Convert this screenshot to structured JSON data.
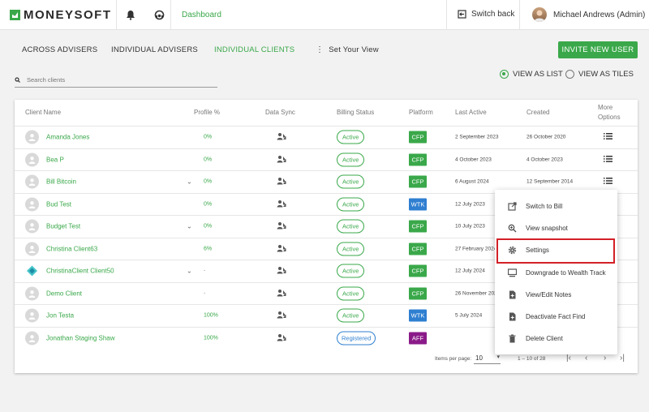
{
  "header": {
    "logo": "MONEYSOFT",
    "dashboard": "Dashboard",
    "switch_back": "Switch back",
    "user_name": "Michael Andrews (Admin)"
  },
  "subnav": {
    "across": "ACROSS ADVISERS",
    "individual_advisers": "INDIVIDUAL ADVISERS",
    "individual_clients": "INDIVIDUAL CLIENTS",
    "set_view": "Set Your View",
    "invite": "INVITE NEW USER"
  },
  "search": {
    "placeholder": "Search clients"
  },
  "view": {
    "list": "VIEW AS LIST",
    "tiles": "VIEW AS TILES",
    "selected": "list"
  },
  "table": {
    "columns": {
      "client_name": "Client Name",
      "profile": "Profile %",
      "data_sync": "Data Sync",
      "billing": "Billing Status",
      "platform": "Platform",
      "last_active": "Last Active",
      "created": "Created",
      "more_1": "More",
      "more_2": "Options"
    },
    "rows": [
      {
        "name": "Amanda Jones",
        "profile": "0%",
        "status": "Active",
        "platform": "CFP",
        "last_active": "2 September 2023",
        "created": "26 October 2020"
      },
      {
        "name": "Bea P",
        "profile": "0%",
        "status": "Active",
        "platform": "CFP",
        "last_active": "4 October 2023",
        "created": "4 October 2023"
      },
      {
        "name": "Bill Bitcoin",
        "profile": "0%",
        "status": "Active",
        "platform": "CFP",
        "last_active": "6 August 2024",
        "created": "12 September 2014"
      },
      {
        "name": "Bud Test",
        "profile": "0%",
        "status": "Active",
        "platform": "WTK",
        "last_active": "12 July 2023",
        "created": ""
      },
      {
        "name": "Budget Test",
        "profile": "0%",
        "status": "Active",
        "platform": "CFP",
        "last_active": "10 July 2023",
        "created": ""
      },
      {
        "name": "Christina Client63",
        "profile": "6%",
        "status": "Active",
        "platform": "CFP",
        "last_active": "27 February 2024",
        "created": ""
      },
      {
        "name": "ChristinaClient Client50",
        "profile": "-",
        "status": "Active",
        "platform": "CFP",
        "last_active": "12 July 2024",
        "created": ""
      },
      {
        "name": "Demo Client",
        "profile": "-",
        "status": "Active",
        "platform": "CFP",
        "last_active": "26 November 2021",
        "created": ""
      },
      {
        "name": "Jon Testa",
        "profile": "100%",
        "status": "Active",
        "platform": "WTK",
        "last_active": "5 July 2024",
        "created": ""
      },
      {
        "name": "Jonathan Staging Shaw",
        "profile": "100%",
        "status": "Registered",
        "platform": "AFF",
        "last_active": "",
        "created": ""
      }
    ]
  },
  "pagination": {
    "items_label": "Items per page:",
    "per_page": "10",
    "range": "1 – 10 of 28"
  },
  "menu": {
    "items": [
      "Switch to Bill",
      "View snapshot",
      "Settings",
      "Downgrade to Wealth Track",
      "View/Edit Notes",
      "Deactivate Fact Find",
      "Delete Client"
    ]
  },
  "colors": {
    "accent": "#3aa84a",
    "cfp": "#3aa84a",
    "wtk": "#2f7fd1",
    "aff": "#8b1a89",
    "highlight": "#d32027"
  }
}
